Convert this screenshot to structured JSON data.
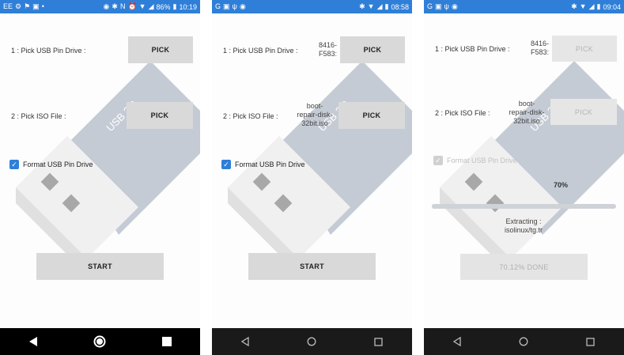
{
  "screens": [
    {
      "status_bar": {
        "battery": "86%",
        "time": "10:19"
      },
      "row1": {
        "label": "1 : Pick USB Pin Drive :",
        "value": "",
        "button": "PICK"
      },
      "row2": {
        "label": "2 : Pick ISO File :",
        "value": "",
        "button": "PICK"
      },
      "format_checkbox": {
        "label": "Format USB Pin Drive",
        "checked": true
      },
      "start_button": "START",
      "art_text": "USB 3.0"
    },
    {
      "status_bar": {
        "battery": "",
        "time": "08:58"
      },
      "row1": {
        "label": "1 : Pick USB Pin Drive :",
        "value": "8416-\nF583:",
        "button": "PICK"
      },
      "row2": {
        "label": "2 : Pick ISO File :",
        "value": "boot-\nrepair-disk-\n32bit.iso",
        "button": "PICK"
      },
      "format_checkbox": {
        "label": "Format USB Pin Drive",
        "checked": true
      },
      "start_button": "START",
      "art_text": "USB 3.0"
    },
    {
      "status_bar": {
        "battery": "",
        "time": "09:04"
      },
      "row1": {
        "label": "1 : Pick USB Pin Drive :",
        "value": "8416-\nF583:",
        "button": "PICK"
      },
      "row2": {
        "label": "2 : Pick ISO File :",
        "value": "boot-\nrepair-disk-\n32bit.iso",
        "button": "PICK"
      },
      "format_checkbox": {
        "label": "Format USB Pin Drive",
        "checked": true
      },
      "progress": {
        "percent_label": "70%",
        "fraction": 0.7
      },
      "extracting_text": "Extracting :\nisolinux/tg.tr",
      "done_button": "70.12% DONE",
      "art_text": "USB 3.0"
    }
  ],
  "colors": {
    "status_bar": "#2f7fd8",
    "accent": "#2f7fd8",
    "art": "#c5cbd5"
  },
  "icons": {
    "nav_back": "back-triangle-icon",
    "nav_home": "home-circle-icon",
    "nav_recents": "recents-square-icon"
  }
}
